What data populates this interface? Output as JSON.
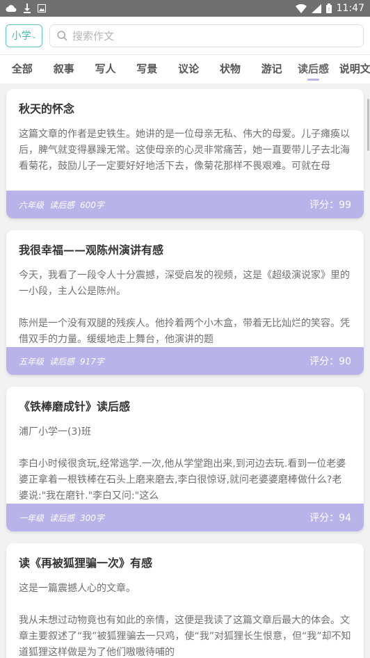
{
  "status": {
    "time": "11:47"
  },
  "search": {
    "grade": "小学",
    "placeholder": "搜索作文"
  },
  "tabs": [
    "全部",
    "叙事",
    "写人",
    "写景",
    "议论",
    "状物",
    "游记",
    "读后感",
    "说明文"
  ],
  "active_tab": "读后感",
  "colors": {
    "accent": "#b8b3e8",
    "teal": "#5cc7c0"
  },
  "essays": [
    {
      "title": "秋天的怀念",
      "body": [
        "这篇文章的作者是史铁生。她讲的是一位母亲无私、伟大的母爱。儿子瘫痪以后，脾气就变得暴躁无常。这使母亲的心灵非常痛苦，她一直要带儿子去北海看菊花，鼓励儿子一定要好好地活下去，像菊花那样不畏艰难。可就在母"
      ],
      "grade": "六年级",
      "category": "读后感",
      "words": "600字",
      "score": "评分：99"
    },
    {
      "title": "我很幸福——观陈州演讲有感",
      "body": [
        "今天，我看了一段令人十分震撼，深受启发的视频，这是《超级演说家》里的一小段，主人公是陈州。",
        "",
        "陈州是一个没有双腿的残疾人。他拎着两个小木盒，带着无比灿烂的笑容。凭借双手的力量。缓缓地走上舞台，他演讲的题"
      ],
      "grade": "五年级",
      "category": "读后感",
      "words": "917字",
      "score": "评分：90"
    },
    {
      "title": "《铁棒磨成针》读后感",
      "body": [
        "浦厂小学一(3)班",
        "",
        "李白小时候很贪玩,经常逃学.一次,他从学堂跑出来,到河边去玩.看到一位老婆婆正拿着一根铁棒在石头上磨来磨去,李白很惊讶,就问老婆婆磨棒做什么?老婆说:\"我在磨针.\"李白又问:\"这么"
      ],
      "grade": "一年级",
      "category": "读后感",
      "words": "300字",
      "score": "评分：94"
    },
    {
      "title": "读《再被狐狸骗一次》有感",
      "body": [
        "这是一篇震撼人心的文章。",
        "",
        "我从未想过动物竟也有如此的亲情，这便是我读了这篇文章后最大的体会。文章主要叙述了“我”被狐狸骗去一只鸡，使“我”对狐狸长生恨意，但“我”却不知道狐狸这样做是为了他们嗷嗷待哺的"
      ],
      "grade": "",
      "category": "",
      "words": "",
      "score": ""
    }
  ]
}
